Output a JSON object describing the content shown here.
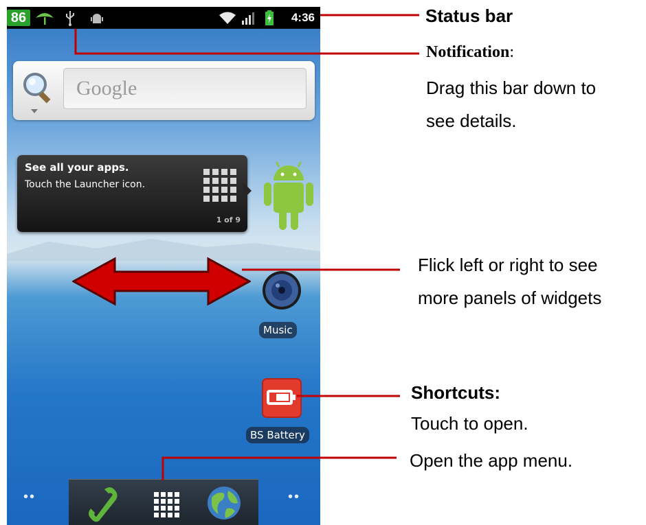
{
  "status_bar": {
    "badge": "86",
    "clock": "4:36",
    "icons": [
      "leaf-icon",
      "usb-icon",
      "android-debug-icon",
      "wifi-icon",
      "signal-icon",
      "battery-charging-icon"
    ]
  },
  "search_widget": {
    "placeholder": "Google",
    "icon": "magnifier-icon"
  },
  "tip_bubble": {
    "title": "See all your apps.",
    "text": "Touch the Launcher icon.",
    "page": "1 of 9"
  },
  "apps": {
    "music": "Music",
    "battery": "BS Battery"
  },
  "dock": {
    "icons": [
      "phone-icon",
      "launcher-grid-icon",
      "browser-globe-icon"
    ]
  },
  "callouts": {
    "status_bar": "Status bar",
    "notification_title": "Notification",
    "notification_colon": ":",
    "notification_line1": "Drag this bar down to",
    "notification_line2": "see details.",
    "flick_line1": "Flick left or right to see",
    "flick_line2": "more panels of widgets",
    "shortcuts_title": "Shortcuts:",
    "shortcuts_text": "Touch to open.",
    "app_menu": "Open the app menu."
  },
  "colors": {
    "callout_line": "#c00000",
    "status_badge": "#2aa12a",
    "arrow": "#d00000"
  }
}
